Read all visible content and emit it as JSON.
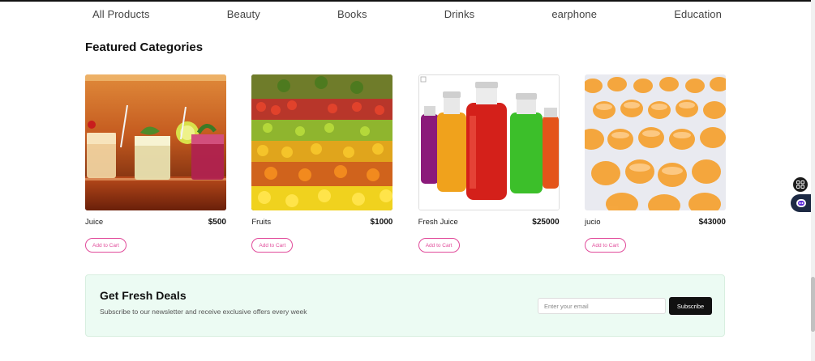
{
  "nav": {
    "items": [
      "All Products",
      "Beauty",
      "Books",
      "Drinks",
      "earphone",
      "Education"
    ]
  },
  "featured": {
    "title": "Featured Categories",
    "cards": [
      {
        "name": "Juice",
        "price": "$500",
        "button": "Add to Cart",
        "image": "cocktail-glasses-photo"
      },
      {
        "name": "Fruits",
        "price": "$1000",
        "button": "Add to Cart",
        "image": "fruit-stand-photo"
      },
      {
        "name": "Fresh Juice",
        "price": "$25000",
        "button": "Add to Cart",
        "image": "juice-bottles-photo"
      },
      {
        "name": "jucio",
        "price": "$43000",
        "button": "Add to Cart",
        "image": "orange-juice-glasses-photo"
      }
    ]
  },
  "newsletter": {
    "title": "Get Fresh Deals",
    "subtitle": "Subscribe to our newsletter and receive exclusive offers every week",
    "email_placeholder": "Enter your email",
    "subscribe_label": "Subscribe"
  },
  "floating": {
    "icon1": "grid-icon",
    "icon2": "chat-bot-icon"
  },
  "colors": {
    "accent_pink": "#e14b9a",
    "deals_background": "#ecfbf3",
    "button_dark": "#111111"
  }
}
